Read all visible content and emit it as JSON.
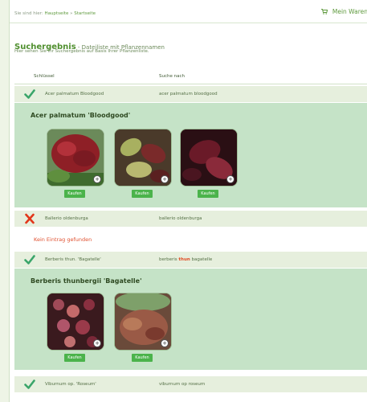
{
  "breadcrumb": {
    "prefix": "Sie sind hier:",
    "home": "Hauptseite",
    "separator": "»",
    "current": "Startseite"
  },
  "cart": {
    "label": "Mein Waren"
  },
  "heading": {
    "title": "Suchergebnis",
    "subtitle": " - Dateiliste mit Pflanzennamen"
  },
  "intro": "Hier sehen Sie Ihr Suchergebnis auf Basis Ihrer Pflanzenliste.",
  "table": {
    "col_key": "Schlüssel",
    "col_query": "Suche nach"
  },
  "buy_label": "Kaufen",
  "not_found": "Kein Eintrag gefunden",
  "results": [
    {
      "status": "found",
      "key": "Acer palmatum Bloodgood",
      "query": "acer palmatum bloodgood",
      "plant": "Acer palmatum 'Bloodgood'"
    },
    {
      "status": "missing",
      "key": "Ballerio oldenburga",
      "query": "ballerio oldenburga"
    },
    {
      "status": "found",
      "key": "Berberis thun. 'Bagatelle'",
      "query_before": "berberis ",
      "query_highlight": "thun",
      "query_after": " bagatelle",
      "plant": "Berberis thunbergii 'Bagatelle'"
    },
    {
      "status": "found",
      "key": "Viburnum op. 'Roseum'",
      "query": "viburnum op roseum"
    }
  ],
  "colors": {
    "accent": "#4f8f2e",
    "check": "#3aa56a",
    "cross": "#e2361a",
    "panel": "#c5e3c7",
    "buy": "#4bb34b",
    "highlight": "#e04a22"
  }
}
